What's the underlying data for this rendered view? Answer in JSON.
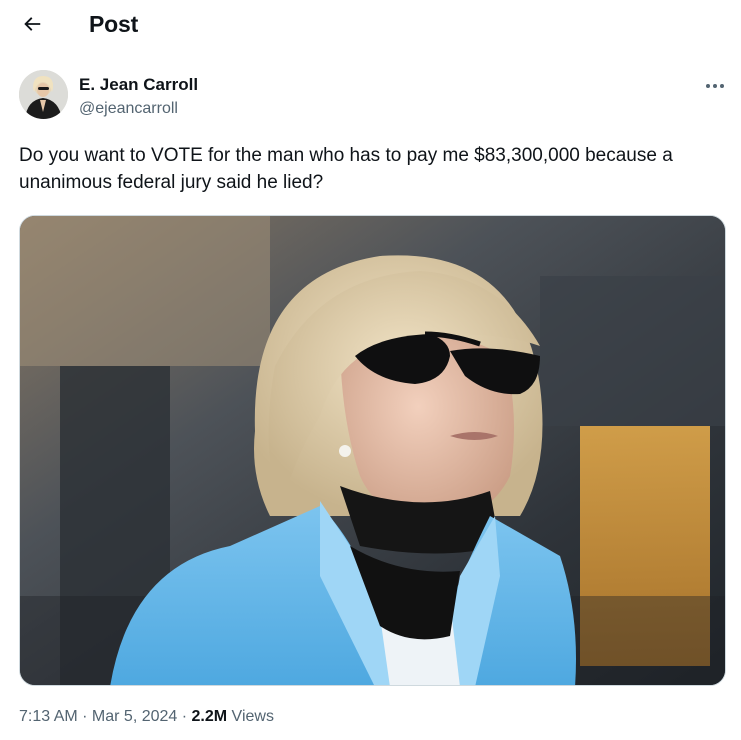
{
  "header": {
    "title": "Post",
    "back_icon": "arrow-left-icon"
  },
  "author": {
    "name": "E. Jean Carroll",
    "handle": "@ejeancarroll",
    "avatar_icon": "avatar-photo"
  },
  "more_icon": "more-horizontal-icon",
  "tweet": {
    "text": "Do you want to VOTE for the man who has to pay me $83,300,000 because a unanimous federal jury said he lied?"
  },
  "media": {
    "type": "photo"
  },
  "meta": {
    "time": "7:13 AM",
    "separator1": " · ",
    "date": "Mar 5, 2024",
    "separator2": " · ",
    "views_count": "2.2M",
    "views_label": " Views"
  },
  "colors": {
    "text_primary": "#0f1419",
    "text_secondary": "#536471",
    "border": "#cfd9de",
    "background": "#ffffff"
  }
}
